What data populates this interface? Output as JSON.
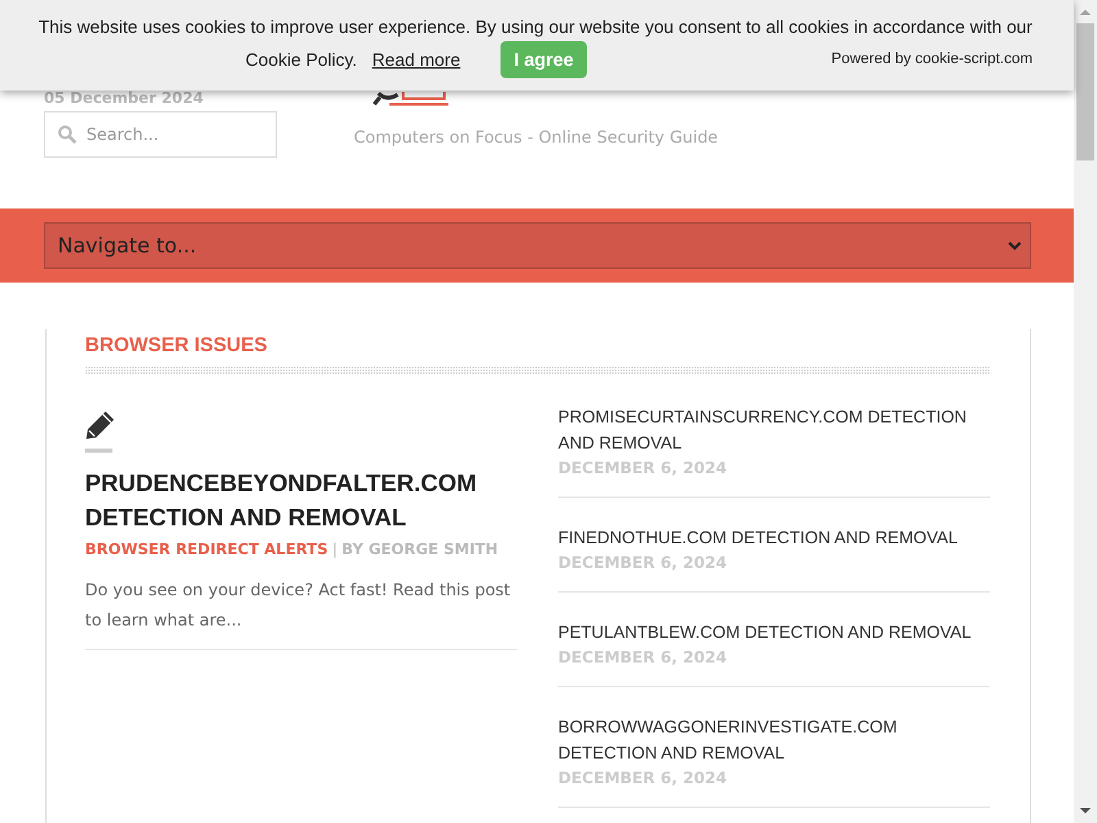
{
  "cookie_banner": {
    "message": "This website uses cookies to improve user experience. By using our website you consent to all cookies in accordance with our",
    "policy_text": "Cookie Policy.",
    "read_more": "Read more",
    "agree_button": "I agree",
    "powered_by": "Powered by cookie-script.com"
  },
  "header": {
    "date": "05 December 2024",
    "search": {
      "placeholder": "Search..."
    },
    "tagline": "Computers on Focus - Online Security Guide"
  },
  "navigation": {
    "select_value": "Navigate to..."
  },
  "section": {
    "title": "BROWSER ISSUES",
    "featured": {
      "title": "PRUDENCEBEYONDFALTER.COM DETECTION AND REMOVAL",
      "category": "BROWSER REDIRECT ALERTS",
      "separator": "|",
      "author": "BY GEORGE SMITH",
      "excerpt": "Do you see on your device? Act fast! Read this post to learn what are..."
    },
    "posts": [
      {
        "title": "PROMISECURTAINSCURRENCY.COM DETECTION AND REMOVAL",
        "date": "DECEMBER 6, 2024"
      },
      {
        "title": "FINEDNOTHUE.COM DETECTION AND REMOVAL",
        "date": "DECEMBER 6, 2024"
      },
      {
        "title": "PETULANTBLEW.COM DETECTION AND REMOVAL",
        "date": "DECEMBER 6, 2024"
      },
      {
        "title": "BORROWWAGGONERINVESTIGATE.COM DETECTION AND REMOVAL",
        "date": "DECEMBER 6, 2024"
      }
    ]
  }
}
